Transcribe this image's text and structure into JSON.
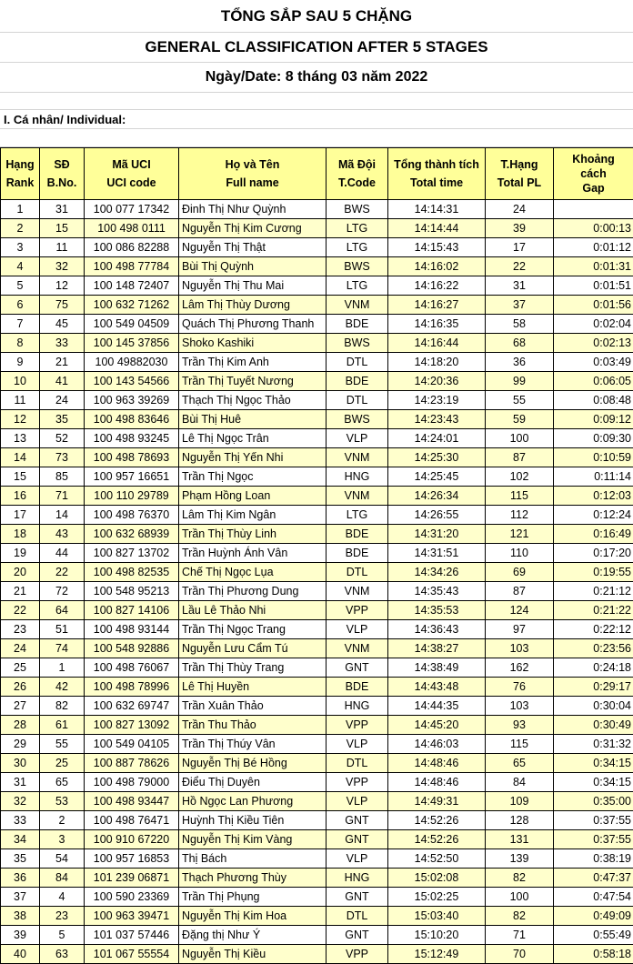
{
  "title_vi": "TỔNG SẮP SAU 5 CHẶNG",
  "title_en": "GENERAL CLASSIFICATION AFTER 5 STAGES",
  "date": "Ngày/Date: 8 tháng 03 năm 2022",
  "section": "I. Cá nhân/ Individual:",
  "headers": [
    {
      "vi": "Hạng",
      "en": "Rank"
    },
    {
      "vi": "SĐ",
      "en": "B.No."
    },
    {
      "vi": "Mã UCI",
      "en": "UCI code"
    },
    {
      "vi": "Họ và Tên",
      "en": "Full name"
    },
    {
      "vi": "Mã Đội",
      "en": "T.Code"
    },
    {
      "vi": "Tổng thành tích",
      "en": "Total time"
    },
    {
      "vi": "T.Hạng",
      "en": "Total PL"
    },
    {
      "vi": "Khoảng cách",
      "en": "Gap"
    }
  ],
  "rows": [
    [
      "1",
      "31",
      "100 077 17342",
      "Đinh Thị Như Quỳnh",
      "BWS",
      "14:14:31",
      "24",
      ""
    ],
    [
      "2",
      "15",
      "100 498 0111",
      "Nguyễn Thị Kim Cương",
      "LTG",
      "14:14:44",
      "39",
      "0:00:13"
    ],
    [
      "3",
      "11",
      "100 086 82288",
      "Nguyễn Thị Thật",
      "LTG",
      "14:15:43",
      "17",
      "0:01:12"
    ],
    [
      "4",
      "32",
      "100 498 77784",
      "Bùi Thị Quỳnh",
      "BWS",
      "14:16:02",
      "22",
      "0:01:31"
    ],
    [
      "5",
      "12",
      "100 148 72407",
      "Nguyễn Thị Thu Mai",
      "LTG",
      "14:16:22",
      "31",
      "0:01:51"
    ],
    [
      "6",
      "75",
      "100 632 71262",
      "Lâm Thị Thùy Dương",
      "VNM",
      "14:16:27",
      "37",
      "0:01:56"
    ],
    [
      "7",
      "45",
      "100 549 04509",
      "Quách Thị Phương Thanh",
      "BDE",
      "14:16:35",
      "58",
      "0:02:04"
    ],
    [
      "8",
      "33",
      "100 145 37856",
      "Shoko Kashiki",
      "BWS",
      "14:16:44",
      "68",
      "0:02:13"
    ],
    [
      "9",
      "21",
      "100 49882030",
      "Trần Thị Kim Anh",
      "DTL",
      "14:18:20",
      "36",
      "0:03:49"
    ],
    [
      "10",
      "41",
      "100 143 54566",
      "Trần Thị Tuyết Nương",
      "BDE",
      "14:20:36",
      "99",
      "0:06:05"
    ],
    [
      "11",
      "24",
      "100 963 39269",
      "Thạch Thị Ngọc Thảo",
      "DTL",
      "14:23:19",
      "55",
      "0:08:48"
    ],
    [
      "12",
      "35",
      "100 498 83646",
      "Bùi Thị Huê",
      "BWS",
      "14:23:43",
      "59",
      "0:09:12"
    ],
    [
      "13",
      "52",
      "100 498 93245",
      "Lê Thị Ngọc Trân",
      "VLP",
      "14:24:01",
      "100",
      "0:09:30"
    ],
    [
      "14",
      "73",
      "100 498 78693",
      "Nguyễn Thị Yến Nhi",
      "VNM",
      "14:25:30",
      "87",
      "0:10:59"
    ],
    [
      "15",
      "85",
      "100 957 16651",
      "Trần Thị Ngọc",
      "HNG",
      "14:25:45",
      "102",
      "0:11:14"
    ],
    [
      "16",
      "71",
      "100 110 29789",
      "Phạm Hồng Loan",
      "VNM",
      "14:26:34",
      "115",
      "0:12:03"
    ],
    [
      "17",
      "14",
      "100 498 76370",
      "Lâm Thị Kim Ngân",
      "LTG",
      "14:26:55",
      "112",
      "0:12:24"
    ],
    [
      "18",
      "43",
      "100 632 68939",
      "Trần Thị Thùy Linh",
      "BDE",
      "14:31:20",
      "121",
      "0:16:49"
    ],
    [
      "19",
      "44",
      "100 827 13702",
      "Trần Huỳnh Ánh Vân",
      "BDE",
      "14:31:51",
      "110",
      "0:17:20"
    ],
    [
      "20",
      "22",
      "100 498 82535",
      "Chế Thị Ngọc Lụa",
      "DTL",
      "14:34:26",
      "69",
      "0:19:55"
    ],
    [
      "21",
      "72",
      "100 548 95213",
      "Trần Thị Phương Dung",
      "VNM",
      "14:35:43",
      "87",
      "0:21:12"
    ],
    [
      "22",
      "64",
      "100 827 14106",
      "Lầu Lê Thảo Nhi",
      "VPP",
      "14:35:53",
      "124",
      "0:21:22"
    ],
    [
      "23",
      "51",
      "100 498 93144",
      "Trần Thị Ngọc Trang",
      "VLP",
      "14:36:43",
      "97",
      "0:22:12"
    ],
    [
      "24",
      "74",
      "100 548 92886",
      "Nguyễn Lưu Cẩm Tú",
      "VNM",
      "14:38:27",
      "103",
      "0:23:56"
    ],
    [
      "25",
      "1",
      "100 498 76067",
      "Trần Thị Thùy Trang",
      "GNT",
      "14:38:49",
      "162",
      "0:24:18"
    ],
    [
      "26",
      "42",
      "100 498 78996",
      "Lê Thị Huyền",
      "BDE",
      "14:43:48",
      "76",
      "0:29:17"
    ],
    [
      "27",
      "82",
      "100 632 69747",
      "Trần Xuân Thảo",
      "HNG",
      "14:44:35",
      "103",
      "0:30:04"
    ],
    [
      "28",
      "61",
      "100 827 13092",
      "Trần Thu Thảo",
      "VPP",
      "14:45:20",
      "93",
      "0:30:49"
    ],
    [
      "29",
      "55",
      "100 549 04105",
      "Trần Thị Thúy Vân",
      "VLP",
      "14:46:03",
      "115",
      "0:31:32"
    ],
    [
      "30",
      "25",
      "100 887 78626",
      "Nguyễn Thị Bé Hồng",
      "DTL",
      "14:48:46",
      "65",
      "0:34:15"
    ],
    [
      "31",
      "65",
      "100 498 79000",
      "Điểu Thị Duyên",
      "VPP",
      "14:48:46",
      "84",
      "0:34:15"
    ],
    [
      "32",
      "53",
      "100 498 93447",
      "Hồ Ngọc Lan Phương",
      "VLP",
      "14:49:31",
      "109",
      "0:35:00"
    ],
    [
      "33",
      "2",
      "100 498 76471",
      "Huỳnh Thị Kiều Tiên",
      "GNT",
      "14:52:26",
      "128",
      "0:37:55"
    ],
    [
      "34",
      "3",
      "100 910 67220",
      "Nguyễn Thị Kim Vàng",
      "GNT",
      "14:52:26",
      "131",
      "0:37:55"
    ],
    [
      "35",
      "54",
      "100 957 16853",
      "Thị Bách",
      "VLP",
      "14:52:50",
      "139",
      "0:38:19"
    ],
    [
      "36",
      "84",
      "101 239 06871",
      "Thạch Phương Thùy",
      "HNG",
      "15:02:08",
      "82",
      "0:47:37"
    ],
    [
      "37",
      "4",
      "100 590 23369",
      "Trần Thị Phụng",
      "GNT",
      "15:02:25",
      "100",
      "0:47:54"
    ],
    [
      "38",
      "23",
      "100 963 39471",
      "Nguyễn Thị Kim Hoa",
      "DTL",
      "15:03:40",
      "82",
      "0:49:09"
    ],
    [
      "39",
      "5",
      "101 037 57446",
      "Đặng thị Như Ý",
      "GNT",
      "15:10:20",
      "71",
      "0:55:49"
    ],
    [
      "40",
      "63",
      "101 067 55554",
      "Nguyễn Thị Kiều",
      "VPP",
      "15:12:49",
      "70",
      "0:58:18"
    ]
  ]
}
